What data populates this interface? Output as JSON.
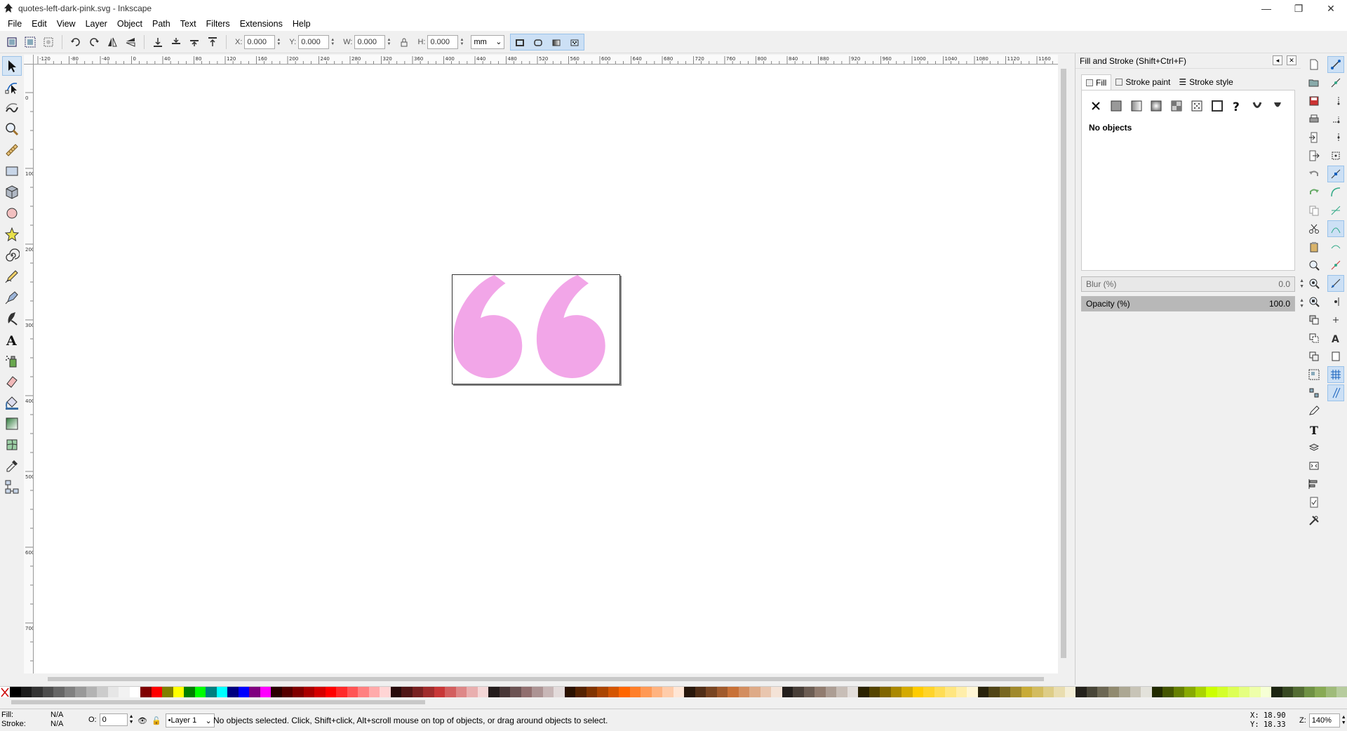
{
  "window": {
    "title": "quotes-left-dark-pink.svg - Inkscape",
    "minimize_label": "—",
    "maximize_label": "❐",
    "close_label": "✕"
  },
  "menu": [
    "File",
    "Edit",
    "View",
    "Layer",
    "Object",
    "Path",
    "Text",
    "Filters",
    "Extensions",
    "Help"
  ],
  "toolcontrols": {
    "x_label": "X:",
    "x_value": "0.000",
    "y_label": "Y:",
    "y_value": "0.000",
    "w_label": "W:",
    "w_value": "0.000",
    "h_label": "H:",
    "h_value": "0.000",
    "unit": "mm"
  },
  "ruler": {
    "top_ticks": [
      "-120",
      "-80",
      "-40",
      "0",
      "40",
      "80",
      "120",
      "160",
      "200",
      "240",
      "280",
      "320",
      "360",
      "400",
      "440",
      "480",
      "520",
      "560",
      "600",
      "640",
      "680",
      "720",
      "760",
      "800",
      "840",
      "880",
      "920",
      "960",
      "1000",
      "1040",
      "1080",
      "1120",
      "1160"
    ],
    "left_ticks": [
      "0",
      "100",
      "200",
      "300",
      "400",
      "500",
      "600",
      "700"
    ]
  },
  "artwork": {
    "quote_color": "#f2a6e8"
  },
  "dock": {
    "title": "Fill and Stroke (Shift+Ctrl+F)",
    "tabs": [
      "Fill",
      "Stroke paint",
      "Stroke style"
    ],
    "status": "No objects",
    "blur_label": "Blur (%)",
    "blur_value": "0.0",
    "opacity_label": "Opacity (%)",
    "opacity_value": "100.0"
  },
  "statusbar": {
    "fill_label": "Fill:",
    "fill_value": "N/A",
    "stroke_label": "Stroke:",
    "stroke_value": "N/A",
    "opacity_label": "O:",
    "opacity_value": "0",
    "layer": "•Layer 1",
    "message": "No objects selected. Click, Shift+click, Alt+scroll mouse on top of objects, or drag around objects to select.",
    "x_coord": "X:   18.90",
    "y_coord": "Y:   18.33",
    "zoom_label": "Z:",
    "zoom_value": "140%"
  },
  "palette": [
    "#000000",
    "#1a1a1a",
    "#333333",
    "#4d4d4d",
    "#666666",
    "#808080",
    "#999999",
    "#b3b3b3",
    "#cccccc",
    "#e6e6e6",
    "#f2f2f2",
    "#ffffff",
    "#800000",
    "#ff0000",
    "#808000",
    "#ffff00",
    "#008000",
    "#00ff00",
    "#008080",
    "#00ffff",
    "#000080",
    "#0000ff",
    "#800080",
    "#ff00ff",
    "#2b0000",
    "#550000",
    "#800000",
    "#aa0000",
    "#d40000",
    "#ff0000",
    "#ff2a2a",
    "#ff5555",
    "#ff8080",
    "#ffaaaa",
    "#ffd5d5",
    "#280b0b",
    "#501616",
    "#782121",
    "#a02c2c",
    "#c83737",
    "#d35f5f",
    "#de8787",
    "#e9afaf",
    "#f4d7d7",
    "#241c1c",
    "#483737",
    "#6c5353",
    "#916f6f",
    "#ac9393",
    "#c8b7b7",
    "#e3dbdb",
    "#2b1100",
    "#552200",
    "#803300",
    "#aa4400",
    "#d45500",
    "#ff6600",
    "#ff7f2a",
    "#ff9955",
    "#ffb380",
    "#ffccaa",
    "#ffe6d5",
    "#28170b",
    "#502d16",
    "#784421",
    "#a05a2c",
    "#c87137",
    "#d38d5f",
    "#deaa87",
    "#e9c6af",
    "#f4e3d7",
    "#241f1c",
    "#483e37",
    "#6c5d53",
    "#917c6f",
    "#ac9d93",
    "#c8beb7",
    "#e3dedb",
    "#2b2200",
    "#554400",
    "#806600",
    "#aa8800",
    "#d4aa00",
    "#ffcc00",
    "#ffd42a",
    "#ffdd55",
    "#ffe680",
    "#ffeeaa",
    "#fff6d5",
    "#28220b",
    "#504416",
    "#786721",
    "#a0892c",
    "#c8ab37",
    "#d3bc5f",
    "#decd87",
    "#e9ddaf",
    "#f4eed7",
    "#24221c",
    "#484537",
    "#6c6753",
    "#918a6f",
    "#aca793",
    "#c8c4b7",
    "#e3e2db",
    "#222b00",
    "#445500",
    "#668000",
    "#88aa00",
    "#aad400",
    "#ccff00",
    "#d4ff2a",
    "#ddff55",
    "#e5ff80",
    "#eeffaa",
    "#f6ffd5",
    "#1c2411",
    "#374822",
    "#536c33",
    "#6f9144",
    "#88aa55",
    "#9fbb7a",
    "#b7cc9e"
  ]
}
